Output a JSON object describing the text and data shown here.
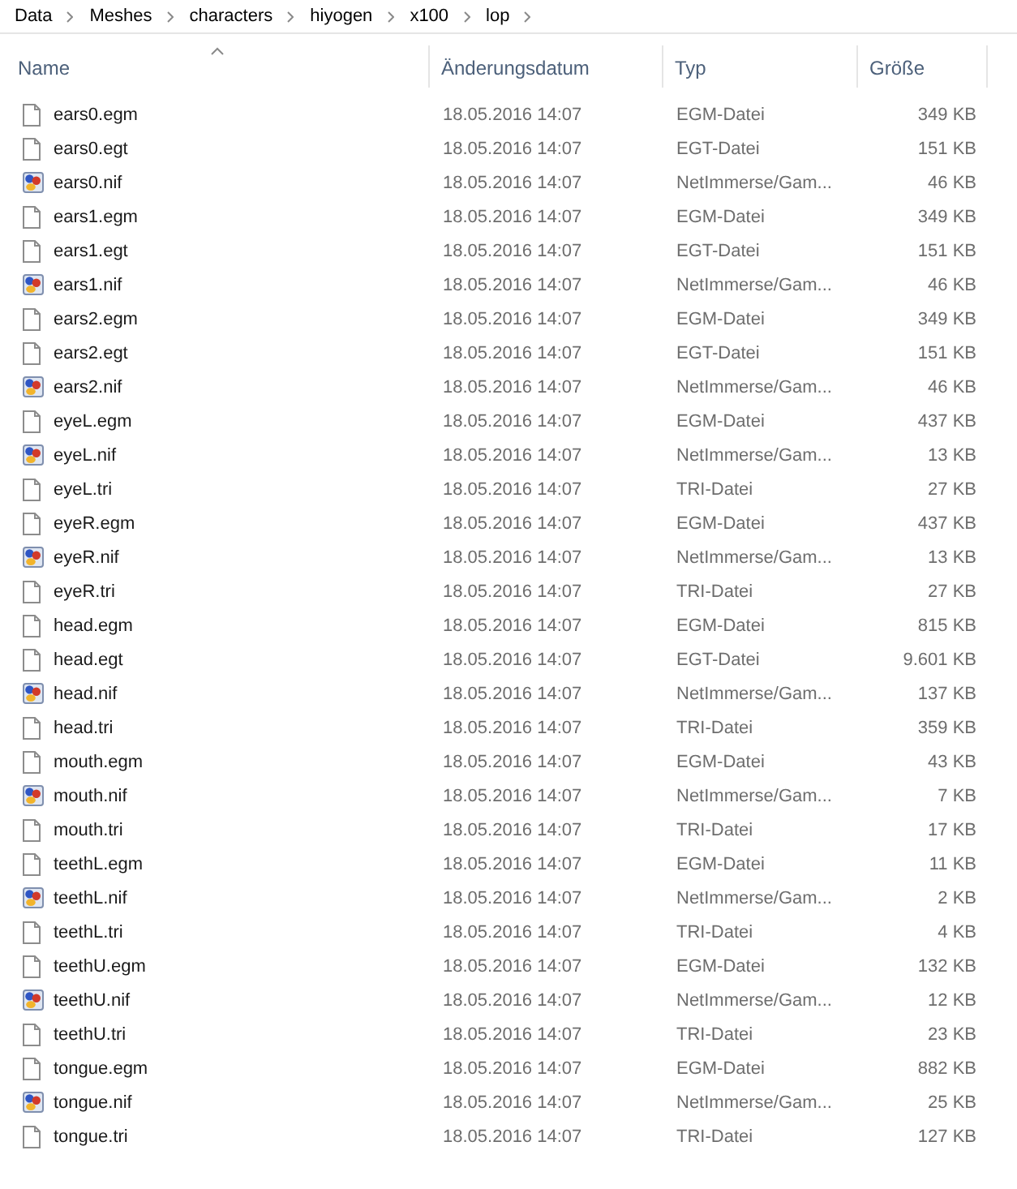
{
  "breadcrumb": [
    {
      "label": "Data"
    },
    {
      "label": "Meshes"
    },
    {
      "label": "characters"
    },
    {
      "label": "hiyogen"
    },
    {
      "label": "x100"
    },
    {
      "label": "lop"
    }
  ],
  "columns": [
    {
      "label": "Name",
      "sorted": true
    },
    {
      "label": "Änderungsdatum",
      "sorted": false
    },
    {
      "label": "Typ",
      "sorted": false
    },
    {
      "label": "Größe",
      "sorted": false
    }
  ],
  "rows": [
    {
      "kind": "document",
      "name": "ears0.egm",
      "date": "18.05.2016 14:07",
      "type": "EGM-Datei",
      "size": "349 KB"
    },
    {
      "kind": "document",
      "name": "ears0.egt",
      "date": "18.05.2016 14:07",
      "type": "EGT-Datei",
      "size": "151 KB"
    },
    {
      "kind": "nif",
      "name": "ears0.nif",
      "date": "18.05.2016 14:07",
      "type": "NetImmerse/Gam...",
      "size": "46 KB"
    },
    {
      "kind": "document",
      "name": "ears1.egm",
      "date": "18.05.2016 14:07",
      "type": "EGM-Datei",
      "size": "349 KB"
    },
    {
      "kind": "document",
      "name": "ears1.egt",
      "date": "18.05.2016 14:07",
      "type": "EGT-Datei",
      "size": "151 KB"
    },
    {
      "kind": "nif",
      "name": "ears1.nif",
      "date": "18.05.2016 14:07",
      "type": "NetImmerse/Gam...",
      "size": "46 KB"
    },
    {
      "kind": "document",
      "name": "ears2.egm",
      "date": "18.05.2016 14:07",
      "type": "EGM-Datei",
      "size": "349 KB"
    },
    {
      "kind": "document",
      "name": "ears2.egt",
      "date": "18.05.2016 14:07",
      "type": "EGT-Datei",
      "size": "151 KB"
    },
    {
      "kind": "nif",
      "name": "ears2.nif",
      "date": "18.05.2016 14:07",
      "type": "NetImmerse/Gam...",
      "size": "46 KB"
    },
    {
      "kind": "document",
      "name": "eyeL.egm",
      "date": "18.05.2016 14:07",
      "type": "EGM-Datei",
      "size": "437 KB"
    },
    {
      "kind": "nif",
      "name": "eyeL.nif",
      "date": "18.05.2016 14:07",
      "type": "NetImmerse/Gam...",
      "size": "13 KB"
    },
    {
      "kind": "document",
      "name": "eyeL.tri",
      "date": "18.05.2016 14:07",
      "type": "TRI-Datei",
      "size": "27 KB"
    },
    {
      "kind": "document",
      "name": "eyeR.egm",
      "date": "18.05.2016 14:07",
      "type": "EGM-Datei",
      "size": "437 KB"
    },
    {
      "kind": "nif",
      "name": "eyeR.nif",
      "date": "18.05.2016 14:07",
      "type": "NetImmerse/Gam...",
      "size": "13 KB"
    },
    {
      "kind": "document",
      "name": "eyeR.tri",
      "date": "18.05.2016 14:07",
      "type": "TRI-Datei",
      "size": "27 KB"
    },
    {
      "kind": "document",
      "name": "head.egm",
      "date": "18.05.2016 14:07",
      "type": "EGM-Datei",
      "size": "815 KB"
    },
    {
      "kind": "document",
      "name": "head.egt",
      "date": "18.05.2016 14:07",
      "type": "EGT-Datei",
      "size": "9.601 KB"
    },
    {
      "kind": "nif",
      "name": "head.nif",
      "date": "18.05.2016 14:07",
      "type": "NetImmerse/Gam...",
      "size": "137 KB"
    },
    {
      "kind": "document",
      "name": "head.tri",
      "date": "18.05.2016 14:07",
      "type": "TRI-Datei",
      "size": "359 KB"
    },
    {
      "kind": "document",
      "name": "mouth.egm",
      "date": "18.05.2016 14:07",
      "type": "EGM-Datei",
      "size": "43 KB"
    },
    {
      "kind": "nif",
      "name": "mouth.nif",
      "date": "18.05.2016 14:07",
      "type": "NetImmerse/Gam...",
      "size": "7 KB"
    },
    {
      "kind": "document",
      "name": "mouth.tri",
      "date": "18.05.2016 14:07",
      "type": "TRI-Datei",
      "size": "17 KB"
    },
    {
      "kind": "document",
      "name": "teethL.egm",
      "date": "18.05.2016 14:07",
      "type": "EGM-Datei",
      "size": "11 KB"
    },
    {
      "kind": "nif",
      "name": "teethL.nif",
      "date": "18.05.2016 14:07",
      "type": "NetImmerse/Gam...",
      "size": "2 KB"
    },
    {
      "kind": "document",
      "name": "teethL.tri",
      "date": "18.05.2016 14:07",
      "type": "TRI-Datei",
      "size": "4 KB"
    },
    {
      "kind": "document",
      "name": "teethU.egm",
      "date": "18.05.2016 14:07",
      "type": "EGM-Datei",
      "size": "132 KB"
    },
    {
      "kind": "nif",
      "name": "teethU.nif",
      "date": "18.05.2016 14:07",
      "type": "NetImmerse/Gam...",
      "size": "12 KB"
    },
    {
      "kind": "document",
      "name": "teethU.tri",
      "date": "18.05.2016 14:07",
      "type": "TRI-Datei",
      "size": "23 KB"
    },
    {
      "kind": "document",
      "name": "tongue.egm",
      "date": "18.05.2016 14:07",
      "type": "EGM-Datei",
      "size": "882 KB"
    },
    {
      "kind": "nif",
      "name": "tongue.nif",
      "date": "18.05.2016 14:07",
      "type": "NetImmerse/Gam...",
      "size": "25 KB"
    },
    {
      "kind": "document",
      "name": "tongue.tri",
      "date": "18.05.2016 14:07",
      "type": "TRI-Datei",
      "size": "127 KB"
    }
  ]
}
